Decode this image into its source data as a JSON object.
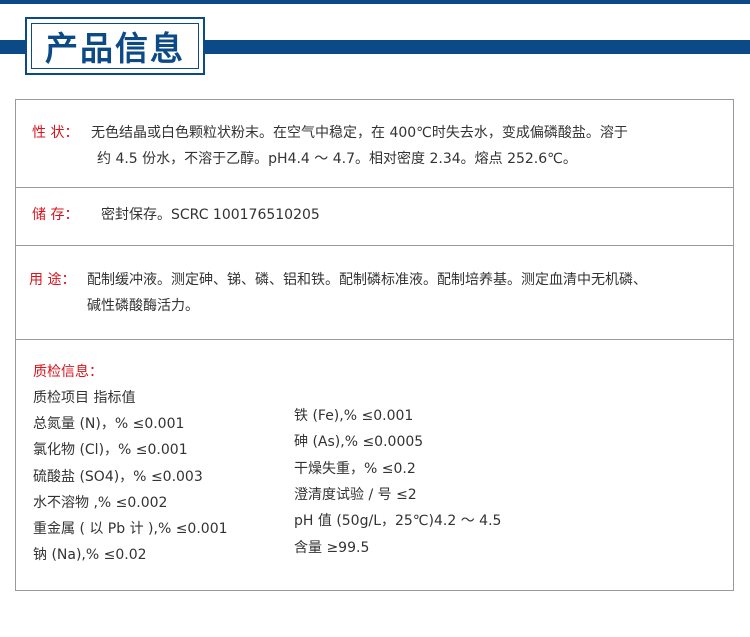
{
  "header": {
    "title": "产品信息"
  },
  "properties": {
    "label": "性 状：",
    "line1": "无色结晶或白色颗粒状粉末。在空气中稳定，在 400℃时失去水，变成偏磷酸盐。溶于",
    "line2": "约 4.5 份水，不溶于乙醇。pH4.4 ～ 4.7。相对密度 2.34。熔点 252.6℃。"
  },
  "storage": {
    "label": "储 存：",
    "text": "密封保存。SCRC 100176510205"
  },
  "usage": {
    "label": "用 途：",
    "line1": "配制缓冲液。测定砷、锑、磷、铝和铁。配制磷标准液。配制培养基。测定血清中无机磷、",
    "line2": "碱性磷酸酶活力。"
  },
  "qc": {
    "title": "质检信息：",
    "header": "质检项目 指标值",
    "left": [
      "总氮量 (N)，% ≤0.001",
      "氯化物 (Cl)，% ≤0.001",
      "硫酸盐 (SO4)，%     ≤0.003",
      "水不溶物 ,%      ≤0.002",
      "重金属 ( 以 Pb 计 ),% ≤0.001",
      "钠 (Na),% ≤0.02"
    ],
    "right": [
      "铁 (Fe),% ≤0.001",
      "砷 (As),% ≤0.0005",
      "干燥失重，%    ≤0.2",
      "澄清度试验 / 号 ≤2",
      "pH 值 (50g/L，25℃)4.2 ～ 4.5",
      "含量 ≥99.5"
    ]
  }
}
